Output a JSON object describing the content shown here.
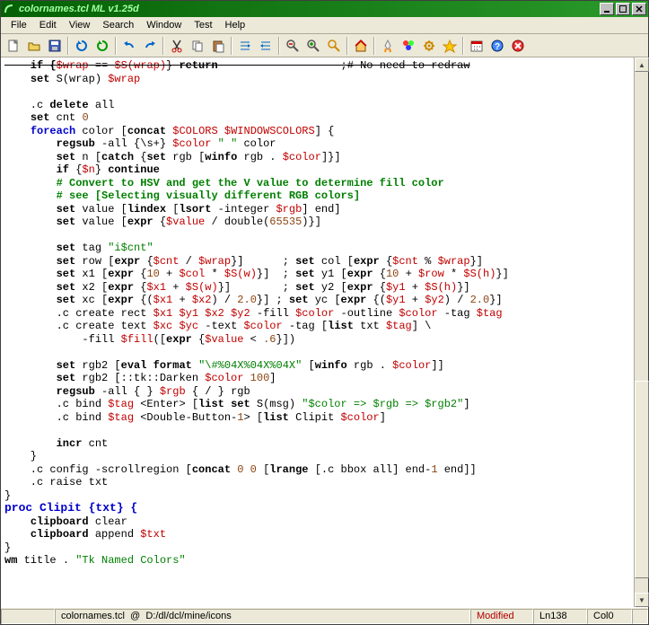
{
  "title": "colornames.tcl    ML v1.25d",
  "menus": [
    "File",
    "Edit",
    "View",
    "Search",
    "Window",
    "Test",
    "Help"
  ],
  "toolbar_icons": [
    "new-file",
    "open-file",
    "save-file",
    "|",
    "refresh",
    "refresh-green",
    "|",
    "undo",
    "redo",
    "|",
    "cut",
    "copy",
    "paste",
    "|",
    "sort-down",
    "sort-up",
    "|",
    "zoom-out",
    "zoom-in",
    "find",
    "|",
    "home",
    "|",
    "rocket",
    "colors",
    "gear",
    "star",
    "|",
    "calendar",
    "help",
    "close-red"
  ],
  "status": {
    "file": "colornames.tcl",
    "at": "@",
    "path": "D:/dl/dcl/mine/icons",
    "modified": "Modified",
    "line": "Ln138",
    "col": "Col0"
  },
  "code": {
    "l1_a": "    if {",
    "l1_b": "$wrap",
    "l1_c": " == ",
    "l1_d": "$S(wrap)",
    "l1_e": "} ",
    "l1_f": "return",
    "l1_g": "                   ;# No need to redraw",
    "l2_a": "    ",
    "l2_b": "set",
    "l2_c": " S(wrap) ",
    "l2_d": "$wrap",
    "l3": "",
    "l4_a": "    .c ",
    "l4_b": "delete",
    "l4_c": " all",
    "l5_a": "    ",
    "l5_b": "set",
    "l5_c": " cnt ",
    "l5_d": "0",
    "l6_a": "    ",
    "l6_b": "foreach",
    "l6_c": " color [",
    "l6_d": "concat",
    "l6_e": " ",
    "l6_f": "$COLORS",
    "l6_g": " ",
    "l6_h": "$WINDOWSCOLORS",
    "l6_i": "] {",
    "l7_a": "        ",
    "l7_b": "regsub",
    "l7_c": " -all {\\s+} ",
    "l7_d": "$color",
    "l7_e": " ",
    "l7_f": "\" \"",
    "l7_g": " color",
    "l8_a": "        ",
    "l8_b": "set",
    "l8_c": " n [",
    "l8_d": "catch",
    "l8_e": " {",
    "l8_f": "set",
    "l8_g": " rgb [",
    "l8_h": "winfo",
    "l8_i": " rgb . ",
    "l8_j": "$color",
    "l8_k": "]}]",
    "l9_a": "        ",
    "l9_b": "if",
    "l9_c": " {",
    "l9_d": "$n",
    "l9_e": "} ",
    "l9_f": "continue",
    "l10": "        # Convert to HSV and get the V value to determine fill color",
    "l11": "        # see [Selecting visually different RGB colors]",
    "l12_a": "        ",
    "l12_b": "set",
    "l12_c": " value [",
    "l12_d": "lindex",
    "l12_e": " [",
    "l12_f": "lsort",
    "l12_g": " -integer ",
    "l12_h": "$rgb",
    "l12_i": "] end]",
    "l13_a": "        ",
    "l13_b": "set",
    "l13_c": " value [",
    "l13_d": "expr",
    "l13_e": " {",
    "l13_f": "$value",
    "l13_g": " / double(",
    "l13_h": "65535",
    "l13_i": ")}]",
    "l14": "",
    "l15_a": "        ",
    "l15_b": "set",
    "l15_c": " tag ",
    "l15_d": "\"i$cnt\"",
    "l16_a": "        ",
    "l16_b": "set",
    "l16_c": " row [",
    "l16_d": "expr",
    "l16_e": " {",
    "l16_f": "$cnt",
    "l16_g": " / ",
    "l16_h": "$wrap",
    "l16_i": "}]      ; ",
    "l16_j": "set",
    "l16_k": " col [",
    "l16_l": "expr",
    "l16_m": " {",
    "l16_n": "$cnt",
    "l16_o": " % ",
    "l16_p": "$wrap",
    "l16_q": "}]",
    "l17_a": "        ",
    "l17_b": "set",
    "l17_c": " x1 [",
    "l17_d": "expr",
    "l17_e": " {",
    "l17_f": "10",
    "l17_g": " + ",
    "l17_h": "$col",
    "l17_i": " * ",
    "l17_j": "$S(w)",
    "l17_k": "}]  ; ",
    "l17_l": "set",
    "l17_m": " y1 [",
    "l17_n": "expr",
    "l17_o": " {",
    "l17_p": "10",
    "l17_q": " + ",
    "l17_r": "$row",
    "l17_s": " * ",
    "l17_t": "$S(h)",
    "l17_u": "}]",
    "l18_a": "        ",
    "l18_b": "set",
    "l18_c": " x2 [",
    "l18_d": "expr",
    "l18_e": " {",
    "l18_f": "$x1",
    "l18_g": " + ",
    "l18_h": "$S(w)",
    "l18_i": "}]        ; ",
    "l18_j": "set",
    "l18_k": " y2 [",
    "l18_l": "expr",
    "l18_m": " {",
    "l18_n": "$y1",
    "l18_o": " + ",
    "l18_p": "$S(h)",
    "l18_q": "}]",
    "l19_a": "        ",
    "l19_b": "set",
    "l19_c": " xc [",
    "l19_d": "expr",
    "l19_e": " {(",
    "l19_f": "$x1",
    "l19_g": " + ",
    "l19_h": "$x2",
    "l19_i": ") / ",
    "l19_j": "2.0",
    "l19_k": "}] ; ",
    "l19_l": "set",
    "l19_m": " yc [",
    "l19_n": "expr",
    "l19_o": " {(",
    "l19_p": "$y1",
    "l19_q": " + ",
    "l19_r": "$y2",
    "l19_s": ") / ",
    "l19_t": "2.0",
    "l19_u": "}]",
    "l20_a": "        .c create rect ",
    "l20_b": "$x1",
    "l20_c": " ",
    "l20_d": "$y1",
    "l20_e": " ",
    "l20_f": "$x2",
    "l20_g": " ",
    "l20_h": "$y2",
    "l20_i": " -fill ",
    "l20_j": "$color",
    "l20_k": " -outline ",
    "l20_l": "$color",
    "l20_m": " -tag ",
    "l20_n": "$tag",
    "l21_a": "        .c create text ",
    "l21_b": "$xc",
    "l21_c": " ",
    "l21_d": "$yc",
    "l21_e": " -text ",
    "l21_f": "$color",
    "l21_g": " -tag [",
    "l21_h": "list",
    "l21_i": " txt ",
    "l21_j": "$tag",
    "l21_k": "] \\",
    "l22_a": "            -fill ",
    "l22_b": "$fill",
    "l22_c": "([",
    "l22_d": "expr",
    "l22_e": " {",
    "l22_f": "$value",
    "l22_g": " < ",
    "l22_h": ".6",
    "l22_i": "}])",
    "l23": "",
    "l24_a": "        ",
    "l24_b": "set",
    "l24_c": " rgb2 [",
    "l24_d": "eval",
    "l24_e": " ",
    "l24_f": "format",
    "l24_g": " ",
    "l24_h": "\"\\#%04X%04X%04X\"",
    "l24_i": " [",
    "l24_j": "winfo",
    "l24_k": " rgb . ",
    "l24_l": "$color",
    "l24_m": "]]",
    "l25_a": "        ",
    "l25_b": "set",
    "l25_c": " rgb2 [::tk::Darken ",
    "l25_d": "$color",
    "l25_e": " ",
    "l25_f": "100",
    "l25_g": "]",
    "l26_a": "        ",
    "l26_b": "regsub",
    "l26_c": " -all { } ",
    "l26_d": "$rgb",
    "l26_e": " { / } rgb",
    "l27_a": "        .c bind ",
    "l27_b": "$tag",
    "l27_c": " <Enter> [",
    "l27_d": "list",
    "l27_e": " ",
    "l27_f": "set",
    "l27_g": " S(msg) ",
    "l27_h": "\"$color => $rgb => $rgb2\"",
    "l27_i": "]",
    "l28_a": "        .c bind ",
    "l28_b": "$tag",
    "l28_c": " <Double-Button-",
    "l28_d": "1",
    "l28_e": "> [",
    "l28_f": "list",
    "l28_g": " Clipit ",
    "l28_h": "$color",
    "l28_i": "]",
    "l29": "",
    "l30_a": "        ",
    "l30_b": "incr",
    "l30_c": " cnt",
    "l31": "    }",
    "l32_a": "    .c config -scrollregion [",
    "l32_b": "concat",
    "l32_c": " ",
    "l32_d": "0",
    "l32_e": " ",
    "l32_f": "0",
    "l32_g": " [",
    "l32_h": "lrange",
    "l32_i": " [.c bbox all] end-",
    "l32_j": "1",
    "l32_k": " end]]",
    "l33": "    .c raise txt",
    "l34": "}",
    "l35": "proc Clipit {txt} {",
    "l36_a": "    ",
    "l36_b": "clipboard",
    "l36_c": " clear",
    "l37_a": "    ",
    "l37_b": "clipboard",
    "l37_c": " append ",
    "l37_d": "$txt",
    "l38": "}",
    "l39_a": "wm",
    "l39_b": " title . ",
    "l39_c": "\"Tk Named Colors\""
  }
}
